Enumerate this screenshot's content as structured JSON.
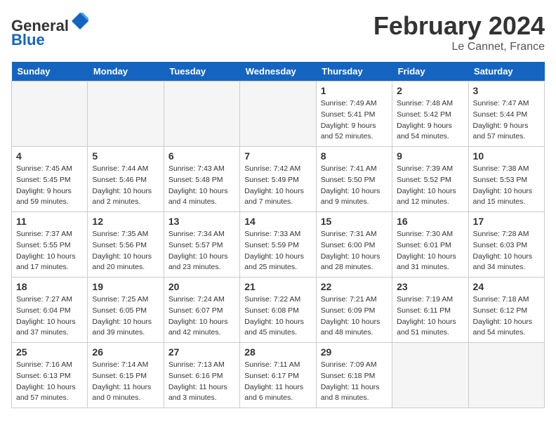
{
  "header": {
    "logo_line1": "General",
    "logo_line2": "Blue",
    "month_title": "February 2024",
    "location": "Le Cannet, France"
  },
  "days_of_week": [
    "Sunday",
    "Monday",
    "Tuesday",
    "Wednesday",
    "Thursday",
    "Friday",
    "Saturday"
  ],
  "weeks": [
    [
      {
        "day": "",
        "info": ""
      },
      {
        "day": "",
        "info": ""
      },
      {
        "day": "",
        "info": ""
      },
      {
        "day": "",
        "info": ""
      },
      {
        "day": "1",
        "info": "Sunrise: 7:49 AM\nSunset: 5:41 PM\nDaylight: 9 hours\nand 52 minutes."
      },
      {
        "day": "2",
        "info": "Sunrise: 7:48 AM\nSunset: 5:42 PM\nDaylight: 9 hours\nand 54 minutes."
      },
      {
        "day": "3",
        "info": "Sunrise: 7:47 AM\nSunset: 5:44 PM\nDaylight: 9 hours\nand 57 minutes."
      }
    ],
    [
      {
        "day": "4",
        "info": "Sunrise: 7:45 AM\nSunset: 5:45 PM\nDaylight: 9 hours\nand 59 minutes."
      },
      {
        "day": "5",
        "info": "Sunrise: 7:44 AM\nSunset: 5:46 PM\nDaylight: 10 hours\nand 2 minutes."
      },
      {
        "day": "6",
        "info": "Sunrise: 7:43 AM\nSunset: 5:48 PM\nDaylight: 10 hours\nand 4 minutes."
      },
      {
        "day": "7",
        "info": "Sunrise: 7:42 AM\nSunset: 5:49 PM\nDaylight: 10 hours\nand 7 minutes."
      },
      {
        "day": "8",
        "info": "Sunrise: 7:41 AM\nSunset: 5:50 PM\nDaylight: 10 hours\nand 9 minutes."
      },
      {
        "day": "9",
        "info": "Sunrise: 7:39 AM\nSunset: 5:52 PM\nDaylight: 10 hours\nand 12 minutes."
      },
      {
        "day": "10",
        "info": "Sunrise: 7:38 AM\nSunset: 5:53 PM\nDaylight: 10 hours\nand 15 minutes."
      }
    ],
    [
      {
        "day": "11",
        "info": "Sunrise: 7:37 AM\nSunset: 5:55 PM\nDaylight: 10 hours\nand 17 minutes."
      },
      {
        "day": "12",
        "info": "Sunrise: 7:35 AM\nSunset: 5:56 PM\nDaylight: 10 hours\nand 20 minutes."
      },
      {
        "day": "13",
        "info": "Sunrise: 7:34 AM\nSunset: 5:57 PM\nDaylight: 10 hours\nand 23 minutes."
      },
      {
        "day": "14",
        "info": "Sunrise: 7:33 AM\nSunset: 5:59 PM\nDaylight: 10 hours\nand 25 minutes."
      },
      {
        "day": "15",
        "info": "Sunrise: 7:31 AM\nSunset: 6:00 PM\nDaylight: 10 hours\nand 28 minutes."
      },
      {
        "day": "16",
        "info": "Sunrise: 7:30 AM\nSunset: 6:01 PM\nDaylight: 10 hours\nand 31 minutes."
      },
      {
        "day": "17",
        "info": "Sunrise: 7:28 AM\nSunset: 6:03 PM\nDaylight: 10 hours\nand 34 minutes."
      }
    ],
    [
      {
        "day": "18",
        "info": "Sunrise: 7:27 AM\nSunset: 6:04 PM\nDaylight: 10 hours\nand 37 minutes."
      },
      {
        "day": "19",
        "info": "Sunrise: 7:25 AM\nSunset: 6:05 PM\nDaylight: 10 hours\nand 39 minutes."
      },
      {
        "day": "20",
        "info": "Sunrise: 7:24 AM\nSunset: 6:07 PM\nDaylight: 10 hours\nand 42 minutes."
      },
      {
        "day": "21",
        "info": "Sunrise: 7:22 AM\nSunset: 6:08 PM\nDaylight: 10 hours\nand 45 minutes."
      },
      {
        "day": "22",
        "info": "Sunrise: 7:21 AM\nSunset: 6:09 PM\nDaylight: 10 hours\nand 48 minutes."
      },
      {
        "day": "23",
        "info": "Sunrise: 7:19 AM\nSunset: 6:11 PM\nDaylight: 10 hours\nand 51 minutes."
      },
      {
        "day": "24",
        "info": "Sunrise: 7:18 AM\nSunset: 6:12 PM\nDaylight: 10 hours\nand 54 minutes."
      }
    ],
    [
      {
        "day": "25",
        "info": "Sunrise: 7:16 AM\nSunset: 6:13 PM\nDaylight: 10 hours\nand 57 minutes."
      },
      {
        "day": "26",
        "info": "Sunrise: 7:14 AM\nSunset: 6:15 PM\nDaylight: 11 hours\nand 0 minutes."
      },
      {
        "day": "27",
        "info": "Sunrise: 7:13 AM\nSunset: 6:16 PM\nDaylight: 11 hours\nand 3 minutes."
      },
      {
        "day": "28",
        "info": "Sunrise: 7:11 AM\nSunset: 6:17 PM\nDaylight: 11 hours\nand 6 minutes."
      },
      {
        "day": "29",
        "info": "Sunrise: 7:09 AM\nSunset: 6:18 PM\nDaylight: 11 hours\nand 8 minutes."
      },
      {
        "day": "",
        "info": ""
      },
      {
        "day": "",
        "info": ""
      }
    ]
  ]
}
